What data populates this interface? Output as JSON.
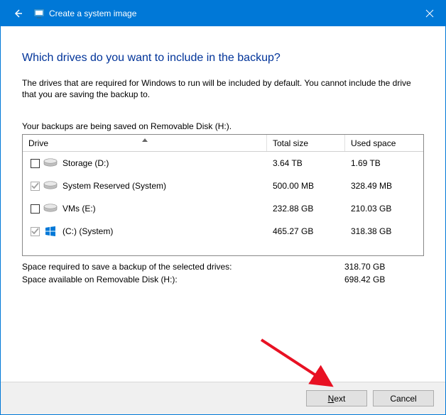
{
  "window": {
    "title": "Create a system image"
  },
  "page": {
    "heading": "Which drives do you want to include in the backup?",
    "description": "The drives that are required for Windows to run will be included by default. You cannot include the drive that you are saving the backup to.",
    "saving_to": "Your backups are being saved on Removable Disk (H:)."
  },
  "table": {
    "columns": {
      "drive": "Drive",
      "total": "Total size",
      "used": "Used space"
    },
    "rows": [
      {
        "checked": false,
        "locked": false,
        "icon": "drive",
        "name": "Storage (D:)",
        "total": "3.64 TB",
        "used": "1.69 TB"
      },
      {
        "checked": true,
        "locked": true,
        "icon": "drive",
        "name": "System Reserved (System)",
        "total": "500.00 MB",
        "used": "328.49 MB"
      },
      {
        "checked": false,
        "locked": false,
        "icon": "drive",
        "name": "VMs (E:)",
        "total": "232.88 GB",
        "used": "210.03 GB"
      },
      {
        "checked": true,
        "locked": true,
        "icon": "windows",
        "name": "(C:) (System)",
        "total": "465.27 GB",
        "used": "318.38 GB"
      }
    ]
  },
  "summary": {
    "required_label": "Space required to save a backup of the selected drives:",
    "required_value": "318.70 GB",
    "available_label": "Space available on Removable Disk (H:):",
    "available_value": "698.42 GB"
  },
  "buttons": {
    "next": "Next",
    "cancel": "Cancel"
  }
}
